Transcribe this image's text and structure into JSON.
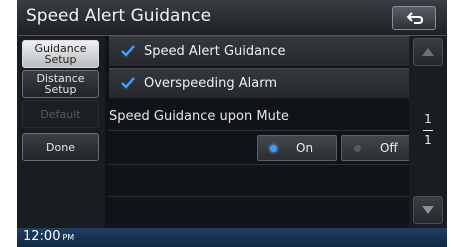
{
  "window": {
    "title": "Speed Alert Guidance"
  },
  "sidebar": {
    "items": [
      {
        "label_line1": "Guidance",
        "label_line2": "Setup",
        "state": "active"
      },
      {
        "label_line1": "Distance",
        "label_line2": "Setup",
        "state": "normal"
      },
      {
        "label_line1": "Default",
        "label_line2": "",
        "state": "disabled"
      },
      {
        "label_line1": "Done",
        "label_line2": "",
        "state": "normal"
      }
    ]
  },
  "settings": {
    "speed_alert_guidance": {
      "label": "Speed Alert Guidance",
      "checked": true
    },
    "overspeeding_alarm": {
      "label": "Overspeeding Alarm",
      "checked": true
    },
    "mute_guidance": {
      "label": "Speed Guidance upon Mute",
      "options": [
        {
          "label": "On",
          "selected": true
        },
        {
          "label": "Off",
          "selected": false
        }
      ]
    }
  },
  "scroll": {
    "current_page": "1",
    "total_pages": "1"
  },
  "status": {
    "time": "12:00",
    "ampm": "PM"
  },
  "colors": {
    "check_blue": "#3f9bff",
    "radio_selected": "#3f9bff",
    "radio_unselected": "#555a60"
  }
}
